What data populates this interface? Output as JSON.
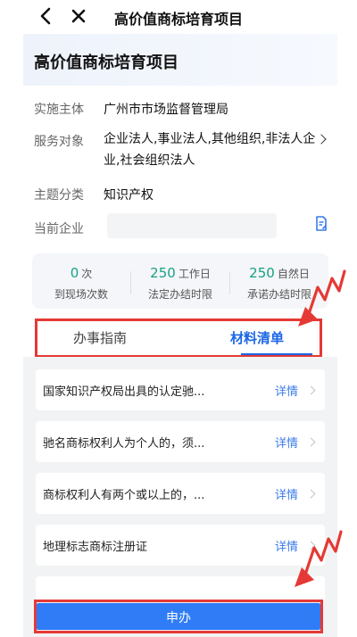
{
  "nav": {
    "title": "高价值商标培育项目",
    "back_icon": "chevron-left-icon",
    "close_icon": "close-icon"
  },
  "header": {
    "title": "高价值商标培育项目"
  },
  "info": {
    "implementer_label": "实施主体",
    "implementer_value": "广州市市场监督管理局",
    "target_label": "服务对象",
    "target_value": "企业法人,事业法人,其他组织,非法人企业,社会组织法人",
    "category_label": "主题分类",
    "category_value": "知识产权",
    "company_label": "当前企业",
    "company_value": ""
  },
  "stats": [
    {
      "num": "0",
      "unit": "次",
      "label": "到现场次数"
    },
    {
      "num": "250",
      "unit": "工作日",
      "label": "法定办结时限"
    },
    {
      "num": "250",
      "unit": "自然日",
      "label": "承诺办结时限"
    }
  ],
  "tabs": {
    "guide": "办事指南",
    "materials": "材料清单"
  },
  "materials": [
    {
      "text": "国家知识产权局出具的认定驰...",
      "detail": "详情"
    },
    {
      "text": "驰名商标权利人为个人的，须...",
      "detail": "详情"
    },
    {
      "text": "商标权利人有两个或以上的，...",
      "detail": "详情"
    },
    {
      "text": "地理标志商标注册证",
      "detail": "详情"
    }
  ],
  "apply": {
    "label": "申办"
  },
  "colors": {
    "accent": "#1a66e6",
    "button": "#2f7cf6",
    "teal": "#16a085",
    "annotation": "#e53935"
  }
}
